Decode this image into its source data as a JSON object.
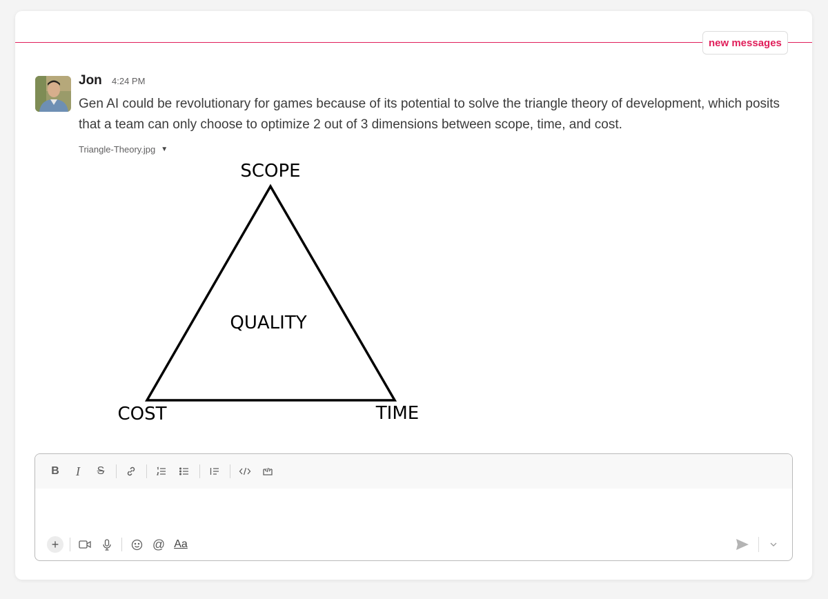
{
  "banner": {
    "label": "new messages"
  },
  "message": {
    "author": "Jon",
    "time": "4:24 PM",
    "text": "Gen AI could be revolutionary for games because of its potential to solve the triangle theory of development, which posits that a team can only choose to optimize 2 out of 3 dimensions between scope, time, and cost.",
    "attachment": {
      "filename": "Triangle-Theory.jpg",
      "labels": {
        "top": "SCOPE",
        "center": "QUALITY",
        "left": "COST",
        "right": "TIME"
      }
    }
  },
  "composer": {
    "format_icons": [
      "bold-icon",
      "italic-icon",
      "strikethrough-icon",
      "link-icon",
      "ordered-list-icon",
      "bulleted-list-icon",
      "blockquote-icon",
      "code-icon",
      "code-block-icon"
    ],
    "bottom_icons": [
      "plus-icon",
      "video-icon",
      "microphone-icon",
      "emoji-icon",
      "mention-icon",
      "text-format-icon",
      "send-icon",
      "chevron-down-icon"
    ],
    "text_format_label": "Aa"
  },
  "colors": {
    "accent": "#e01e5a",
    "text": "#1d1c1d",
    "muted": "#616061"
  }
}
